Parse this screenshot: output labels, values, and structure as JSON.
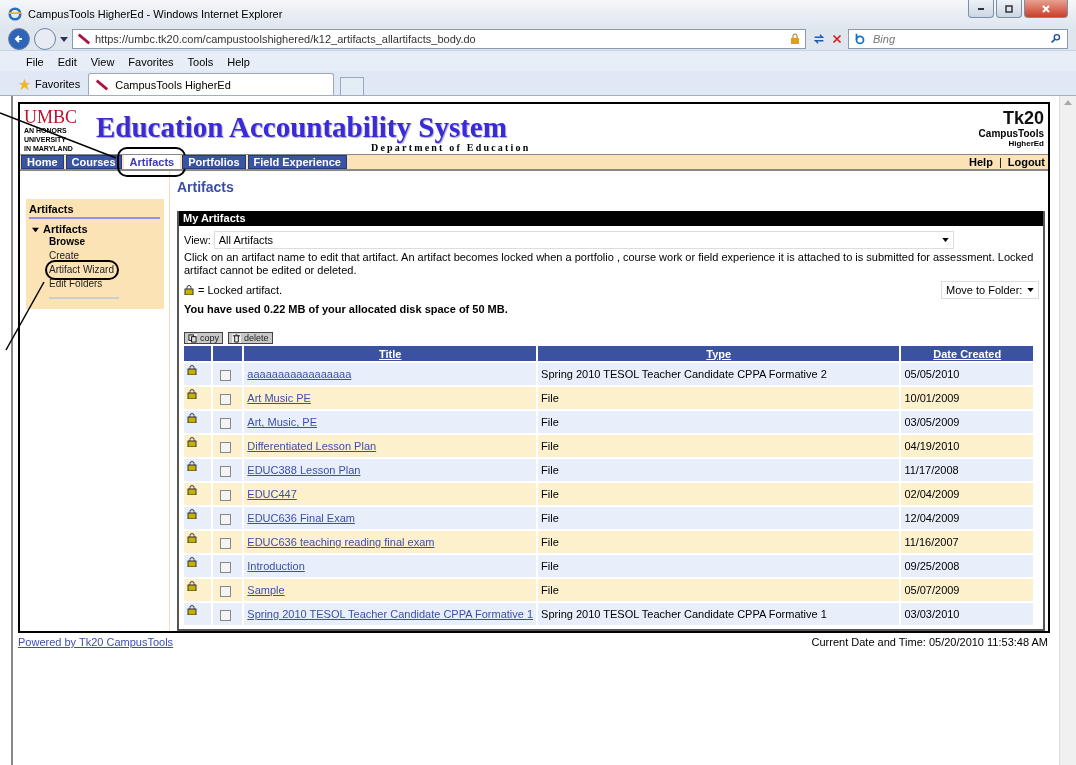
{
  "browser": {
    "title": "CampusTools HigherEd - Windows Internet Explorer",
    "address": "https://umbc.tk20.com/campustoolshighered/k12_artifacts_allartifacts_body.do",
    "search_placeholder": "Bing",
    "menu": [
      "File",
      "Edit",
      "View",
      "Favorites",
      "Tools",
      "Help"
    ],
    "favorites": "Favorites",
    "tab": "CampusTools HigherEd"
  },
  "header": {
    "logo": "UMBC",
    "logo_lines": [
      "AN HONORS",
      "UNIVERSITY",
      "IN MARYLAND"
    ],
    "title": "Education Accountability System",
    "subtitle": "Department of Education",
    "brand": "Tk20",
    "brand_line": "CampusTools",
    "brand_sub": "HigherEd"
  },
  "nav": {
    "tabs": [
      {
        "label": "Home",
        "selected": false,
        "circled": false
      },
      {
        "label": "Courses",
        "selected": false,
        "circled": false
      },
      {
        "label": "Artifacts",
        "selected": true,
        "circled": true
      },
      {
        "label": "Portfolios",
        "selected": false,
        "circled": false
      },
      {
        "label": "Field Experience",
        "selected": false,
        "circled": false
      }
    ],
    "links": [
      "Help",
      "Logout"
    ],
    "separator": "|"
  },
  "sidebar": {
    "heading": "Artifacts",
    "group": {
      "label": "Artifacts",
      "expanded": true
    },
    "items": [
      {
        "label": "Browse",
        "selected": true,
        "circled": false
      },
      {
        "label": "Create",
        "selected": false,
        "circled": false
      },
      {
        "label": "Artifact Wizard",
        "selected": false,
        "circled": true
      },
      {
        "label": "Edit Folders",
        "selected": false,
        "circled": false
      }
    ]
  },
  "main": {
    "heading": "Artifacts",
    "panel_title": "My Artifacts",
    "view_label": "View:",
    "view_value": "All Artifacts",
    "info": "Click on an artifact name to edit that artifact. An artifact becomes locked when a portfolio , course work or field experience it is attached to is submitted for assessment. Locked artifact cannot be edited or deleted.",
    "legend": "= Locked artifact.",
    "move_to_folder": "Move to Folder:",
    "usage": "You have used 0.22 MB of your allocated disk space of 50 MB.",
    "buttons": [
      {
        "label": "copy",
        "kind": "copy",
        "disabled": true
      },
      {
        "label": "delete",
        "kind": "delete",
        "disabled": true
      }
    ],
    "table": {
      "columns": [
        "Title",
        "Type",
        "Date Created"
      ],
      "rows": [
        {
          "title": "aaaaaaaaaaaaaaaaa",
          "type": "Spring 2010 TESOL Teacher Candidate CPPA Formative 2",
          "date": "05/05/2010",
          "locked": true,
          "checked": false
        },
        {
          "title": "Art  Music  PE",
          "type": "File",
          "date": "10/01/2009",
          "locked": true,
          "checked": false
        },
        {
          "title": "Art, Music, PE",
          "type": "File",
          "date": "03/05/2009",
          "locked": true,
          "checked": false
        },
        {
          "title": "Differentiated Lesson Plan",
          "type": "File",
          "date": "04/19/2010",
          "locked": true,
          "checked": false
        },
        {
          "title": "EDUC388 Lesson Plan",
          "type": "File",
          "date": "11/17/2008",
          "locked": true,
          "checked": false
        },
        {
          "title": "EDUC447",
          "type": "File",
          "date": "02/04/2009",
          "locked": true,
          "checked": false
        },
        {
          "title": "EDUC636 Final Exam",
          "type": "File",
          "date": "12/04/2009",
          "locked": true,
          "checked": false
        },
        {
          "title": "EDUC636 teaching reading final exam",
          "type": "File",
          "date": "11/16/2007",
          "locked": true,
          "checked": false
        },
        {
          "title": "Introduction",
          "type": "File",
          "date": "09/25/2008",
          "locked": true,
          "checked": false
        },
        {
          "title": "Sample",
          "type": "File",
          "date": "05/07/2009",
          "locked": true,
          "checked": false
        },
        {
          "title": "Spring 2010 TESOL Teacher Candidate CPPA Formative 1",
          "type": "Spring 2010 TESOL Teacher Candidate CPPA Formative 1",
          "date": "03/03/2010",
          "locked": true,
          "checked": false
        }
      ]
    }
  },
  "footer": {
    "link": "Powered by Tk20 CampusTools",
    "datetime": "Current Date and Time: 05/20/2010 11:53:48 AM"
  }
}
